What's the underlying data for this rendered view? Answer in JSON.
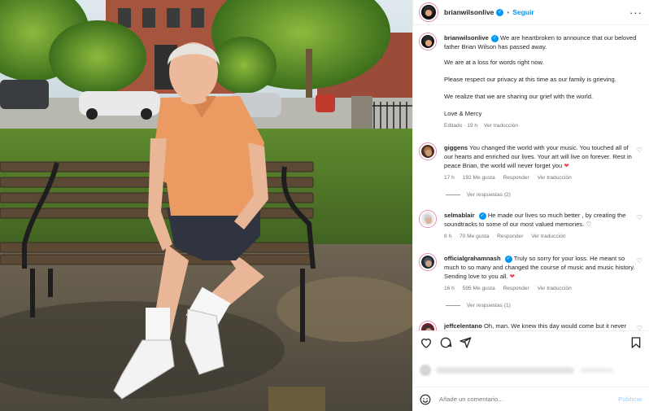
{
  "post": {
    "username": "brianwilsonlive",
    "follow_label": "Seguir",
    "caption_lines": [
      "We are heartbroken to announce that our beloved father Brian Wilson has passed away.",
      "We are at a loss for words right now.",
      "Please respect our privacy at this time as our family is grieving.",
      "We realize that we are sharing our grief with the world.",
      "Love & Mercy"
    ],
    "caption_edited": "Editado · 19 h",
    "caption_translate": "Ver traducción"
  },
  "comments": [
    {
      "username": "giggens",
      "text": "You changed the world with your music. You touched all of our hearts and enriched our lives. Your art will live on forever. Rest in peace Brian, the world will never forget you",
      "emoji": "❤",
      "time": "17 h",
      "likes": "192 Me gusta",
      "reply": "Responder",
      "translate": "Ver traducción",
      "view_replies": "Ver respuestas (2)"
    },
    {
      "username": "selmablair",
      "text": "He made our lives so much better , by creating the soundtracks to some of our most valued memories.",
      "emoji": "♡",
      "time": "8 h",
      "likes": "70 Me gusta",
      "reply": "Responder",
      "translate": "Ver traducción"
    },
    {
      "username": "officialgrahamnash",
      "text": "Truly so sorry for your loss. He meant so much to so many and changed the course of music and music history. Sending love to you all.",
      "emoji": "❤",
      "time": "16 h",
      "likes": "595 Me gusta",
      "reply": "Responder",
      "translate": "Ver traducción",
      "view_replies": "Ver respuestas (1)"
    },
    {
      "username": "jeffcelentano",
      "text": "Oh, man. We knew this day would come but it never makes it any easier. This guy was my BIGGEST musical hero and influence since I was a kid. I'd like to think he's finally"
    }
  ],
  "composer": {
    "placeholder": "Añade un comentario...",
    "post_label": "Publicar"
  },
  "icons": {
    "more": "more-options-icon",
    "like": "heart-icon",
    "comment": "comment-icon",
    "share": "share-icon",
    "save": "bookmark-icon",
    "emoji": "emoji-icon"
  },
  "colors": {
    "accent": "#0095f6",
    "heart_red": "#ed4956",
    "muted": "#737373"
  }
}
